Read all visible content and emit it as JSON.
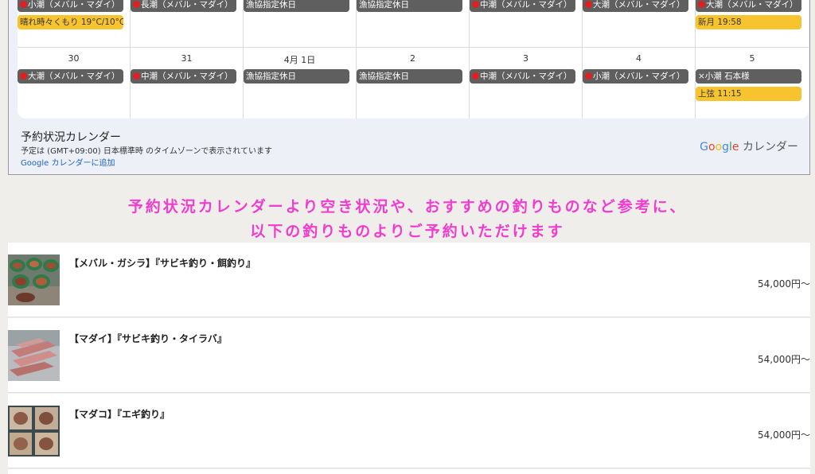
{
  "calendar": {
    "week1": [
      {
        "number": "",
        "chips": [
          {
            "label": "小潮（メバル・マダイ）",
            "style": "dark",
            "dot": true
          },
          {
            "label": "晴れ時々くもり 19°C/10°C",
            "style": "gold",
            "dot": false
          }
        ]
      },
      {
        "number": "",
        "chips": [
          {
            "label": "長潮（メバル・マダイ）",
            "style": "dark",
            "dot": true
          }
        ]
      },
      {
        "number": "",
        "chips": [
          {
            "label": "漁協指定休日",
            "style": "dark",
            "dot": false
          }
        ]
      },
      {
        "number": "",
        "chips": [
          {
            "label": "漁協指定休日",
            "style": "dark",
            "dot": false
          }
        ]
      },
      {
        "number": "",
        "chips": [
          {
            "label": "中潮（メバル・マダイ）",
            "style": "dark",
            "dot": true
          }
        ]
      },
      {
        "number": "",
        "chips": [
          {
            "label": "大潮（メバル・マダイ）",
            "style": "dark",
            "dot": true
          }
        ]
      },
      {
        "number": "",
        "chips": [
          {
            "label": "大潮（メバル・マダイ）",
            "style": "dark",
            "dot": true
          },
          {
            "label": "新月 19:58",
            "style": "gold",
            "dot": false
          }
        ]
      }
    ],
    "week2": [
      {
        "number": "30",
        "chips": [
          {
            "label": "大潮（メバル・マダイ）",
            "style": "dark",
            "dot": true
          }
        ]
      },
      {
        "number": "31",
        "chips": [
          {
            "label": "中潮（メバル・マダイ）",
            "style": "dark",
            "dot": true
          }
        ]
      },
      {
        "number": "4月 1日",
        "chips": [
          {
            "label": "漁協指定休日",
            "style": "dark",
            "dot": false
          }
        ]
      },
      {
        "number": "2",
        "chips": [
          {
            "label": "漁協指定休日",
            "style": "dark",
            "dot": false
          }
        ]
      },
      {
        "number": "3",
        "chips": [
          {
            "label": "中潮（メバル・マダイ）",
            "style": "dark",
            "dot": true
          }
        ]
      },
      {
        "number": "4",
        "chips": [
          {
            "label": "小潮（メバル・マダイ）",
            "style": "dark",
            "dot": true
          }
        ]
      },
      {
        "number": "5",
        "chips": [
          {
            "label": "×小潮 石本様",
            "style": "dark",
            "dot": false
          },
          {
            "label": "上弦 11:15",
            "style": "gold",
            "dot": false
          }
        ]
      }
    ],
    "footer_title": "予約状況カレンダー",
    "footer_timezone": "予定は (GMT+09:00) 日本標準時 のタイムゾーンで表示されています",
    "footer_add_link": "Google カレンダーに追加",
    "logo_text": "カレンダー",
    "colors": {
      "chip_dark": "#5f5f5f",
      "chip_gold": "#f7c42f",
      "dot_red": "#e02020"
    }
  },
  "headline": {
    "line1": "予約状況カレンダーより空き状況や、おすすめの釣りものなど参考に、",
    "line2": "以下の釣りものよりご予約いただけます",
    "color": "#f03ccf"
  },
  "products": [
    {
      "title": "【メバル・ガシラ】『サビキ釣り・餌釣り』",
      "price": "54,000円〜",
      "thumb_icon": "fish-basket-photo"
    },
    {
      "title": "【マダイ】『サビキ釣り・タイラバ』",
      "price": "54,000円〜",
      "thumb_icon": "fish-tray-photo"
    },
    {
      "title": "【マダコ】『エギ釣り』",
      "price": "54,000円〜",
      "thumb_icon": "octopus-box-photo"
    }
  ]
}
